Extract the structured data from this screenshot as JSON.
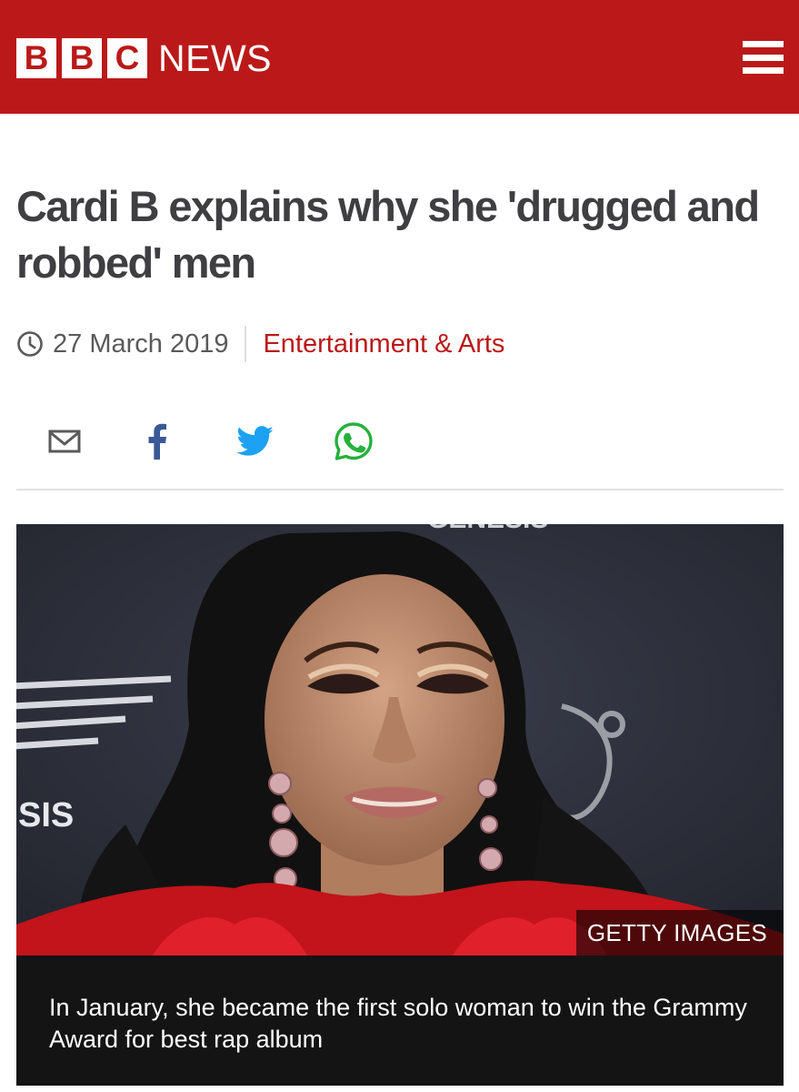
{
  "header": {
    "logo_letters": [
      "B",
      "B",
      "C"
    ],
    "logo_news": "NEWS",
    "menu_icon": "hamburger-menu-icon",
    "background_color": "#bb1919"
  },
  "article": {
    "headline": "Cardi B explains why she 'drugged and robbed' men",
    "date": "27 March 2019",
    "section": "Entertainment & Arts",
    "section_color": "#bb1919"
  },
  "share": {
    "icons": [
      "email-icon",
      "facebook-icon",
      "twitter-icon",
      "whatsapp-icon"
    ]
  },
  "figure": {
    "backdrop_text_top": "GENESIS",
    "backdrop_text_side": "SIS",
    "credit": "GETTY IMAGES",
    "caption": "In January, she became the first solo woman to win the Grammy Award for best rap album"
  }
}
